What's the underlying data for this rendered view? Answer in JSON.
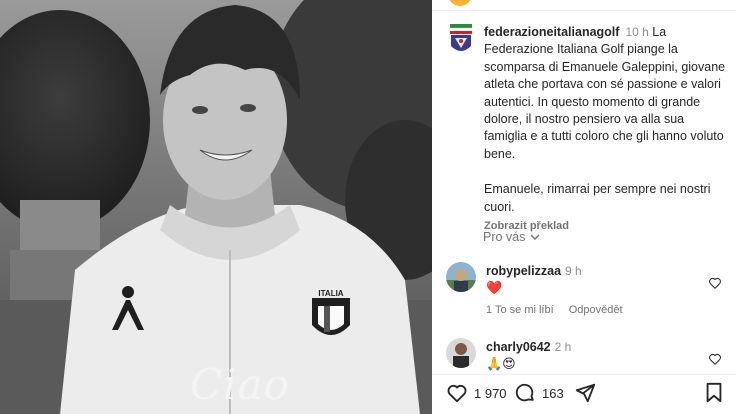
{
  "photo": {
    "caption_script": "Ciao",
    "shirt_badge_text": "ITALIA"
  },
  "post": {
    "username": "federazioneitalianagolf",
    "time": "10 h",
    "text_p1": "La Federazione Italiana Golf piange la scomparsa di Emanuele Galeppini, giovane atleta che portava con sé passione e valori autentici. In questo momento di grande dolore, il nostro pensiero va alla sua famiglia e a tutti coloro che gli hanno voluto bene.",
    "text_p2": "Emanuele, rimarrai per sempre nei nostri cuori.",
    "translate_label": "Zobrazit překlad"
  },
  "for_you": {
    "label": "Pro vás"
  },
  "comments": [
    {
      "username": "robypelizzaa",
      "time": "9 h",
      "emoji": "❤️",
      "like_label": "1 To se mi líbí",
      "reply_label": "Odpovědět"
    },
    {
      "username": "charly0642",
      "time": "2 h",
      "emoji": "🙏😍"
    }
  ],
  "actions": {
    "likes_count": "1 970",
    "comments_count": "163"
  },
  "colors": {
    "text": "#262626",
    "muted": "#737373",
    "accent_heart": "#ff3040"
  }
}
